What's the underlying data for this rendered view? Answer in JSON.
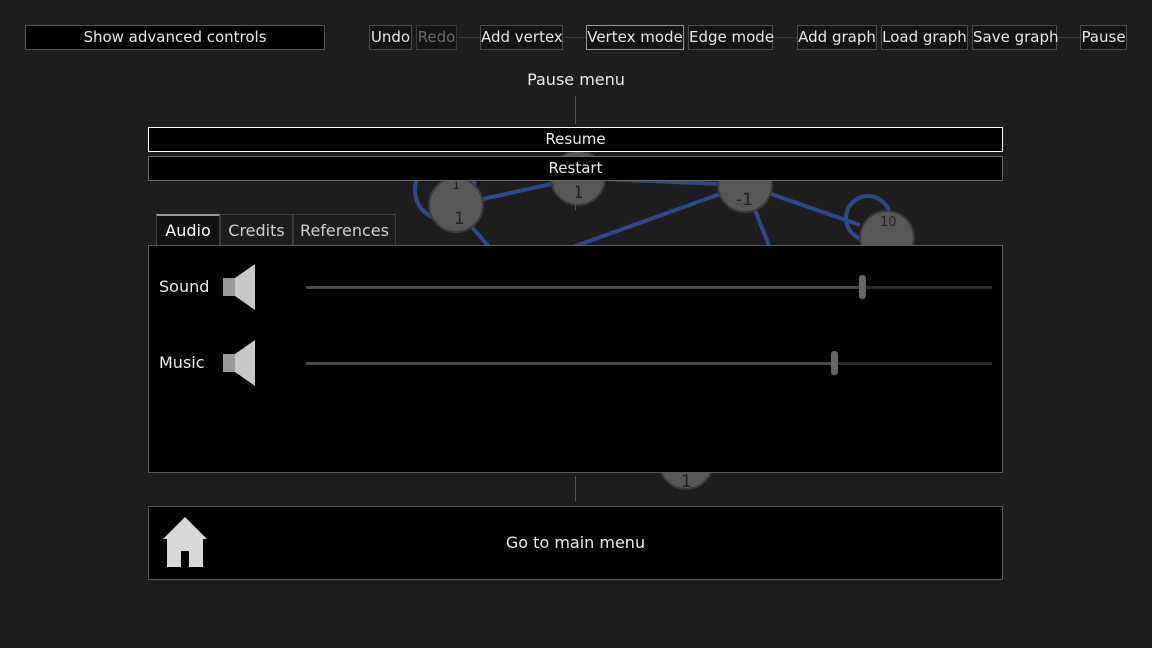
{
  "toolbar": {
    "advanced": "Show advanced controls",
    "undo": "Undo",
    "redo": "Redo",
    "add_vertex": "Add vertex",
    "vertex_mode": "Vertex mode",
    "edge_mode": "Edge mode",
    "add_graph": "Add graph",
    "load_graph": "Load graph",
    "save_graph": "Save graph",
    "pause": "Pause"
  },
  "pause_menu": {
    "title": "Pause menu",
    "resume": "Resume",
    "restart": "Restart",
    "tabs": [
      "Audio",
      "Credits",
      "References"
    ],
    "active_tab": "Audio",
    "audio": {
      "sound": {
        "label": "Sound",
        "level": 0.81
      },
      "music": {
        "label": "Music",
        "level": 0.77
      }
    },
    "main_menu": "Go to main menu"
  },
  "graph_labels": {
    "n1_top": "1",
    "n1_bottom": "1",
    "n2": "1",
    "n3": "-1",
    "n4": "10",
    "n5": "1"
  },
  "colors": {
    "edge": "#2c4a8a",
    "node": "#575757",
    "panel": "#000000",
    "background": "#1d1d1d"
  },
  "icons": {
    "speaker": "speaker-icon",
    "home": "home-icon"
  }
}
